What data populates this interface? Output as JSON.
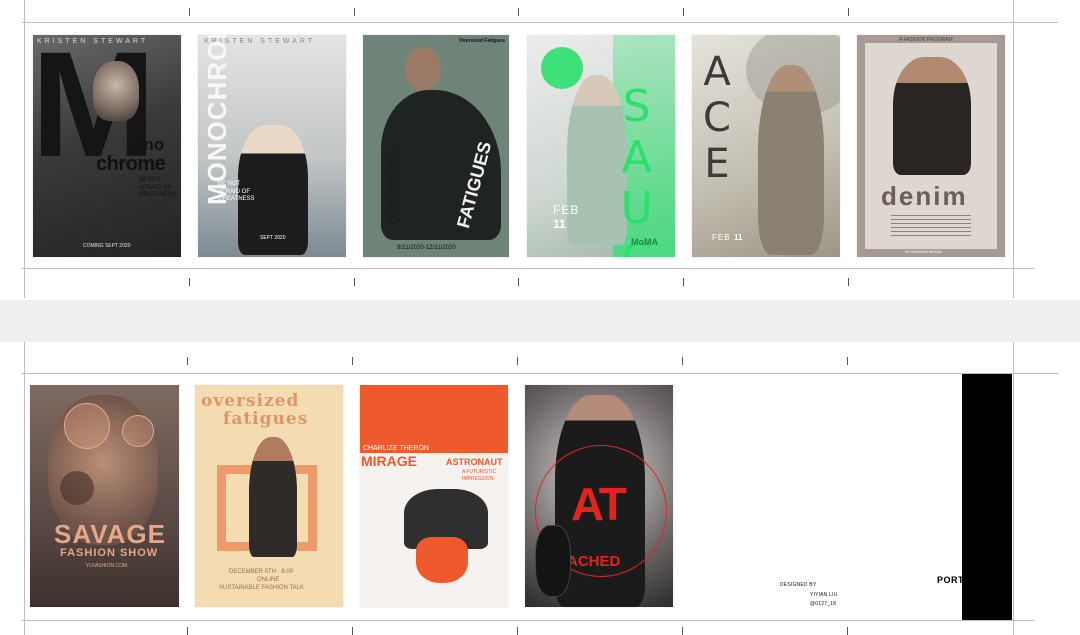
{
  "row1": {
    "posters": [
      {
        "name": "poster-monochrome-1",
        "bg": "#4a4a4a",
        "header": "KRISTEN STEWART",
        "big_letter": "M",
        "title_a": "ono",
        "title_b": "chrome",
        "tagline": "BE NOT AFRAID OF GREATNESS",
        "footer": "COMING SEPT 2020"
      },
      {
        "name": "poster-monochrome-2",
        "bg": "#c8cbcc",
        "header": "KRISTEN STEWART",
        "title": "MONOCHROME",
        "tagline": "BE NOT AFRAID OF GREATNESS",
        "footer": "SEPT 2020"
      },
      {
        "name": "poster-oversized-fatigues-1",
        "bg": "#6e8478",
        "corner": "Oversized Fatigues",
        "title_a": "OVERSIZED",
        "title_b": "FATIGUES",
        "dates": "9/21/2020-12/31/2020"
      },
      {
        "name": "poster-sauce",
        "bg": "#dfe6e1",
        "accent": "#3ee07a",
        "title": "SAUCE",
        "month": "FEB",
        "day": "11",
        "sponsor": "MoMA"
      },
      {
        "name": "poster-ace",
        "bg": "#c9c4b7",
        "title": "ACE",
        "month": "FEB",
        "day": "11"
      },
      {
        "name": "poster-denim",
        "bg": "#d9d2cd",
        "frame": "#a79a95",
        "header": "A FASHION PROGRAM",
        "title": "denim",
        "footer": "IN FASHION MEDIA"
      }
    ]
  },
  "row2": {
    "posters": [
      {
        "name": "poster-savage",
        "bg": "#6c5b55",
        "accent": "#e6a688",
        "title": "SAVAGE",
        "subtitle": "FASHION SHOW",
        "site": "YLFASHION.COM"
      },
      {
        "name": "poster-oversized-fatigues-2",
        "bg": "#f3dcb1",
        "accent": "#e89a6c",
        "title_a": "oversized",
        "title_b": "fatigues",
        "line1": "DECEMBER 5TH · 8:00",
        "line2": "ONLINE",
        "line3": "SUSTAINABLE FASHION TALK"
      },
      {
        "name": "poster-mirage",
        "bg": "#f4f1ee",
        "accent": "#ee5a2e",
        "actor": "CHARLIZE THERON",
        "title": "MIRAGE",
        "title_b": "ASTRONAUT",
        "sub": "A FUTURISTIC IMPRESSION"
      },
      {
        "name": "poster-attached",
        "bg": "#2b2a2c",
        "accent": "#e2241f",
        "title_a": "AT",
        "title_b": "ACHED"
      }
    ]
  },
  "credits": {
    "designed_by": "DESIGNED BY",
    "designer": "YIYIAN LIU",
    "handle": "@0127_18",
    "portfolio": "PORTFOLIO"
  }
}
